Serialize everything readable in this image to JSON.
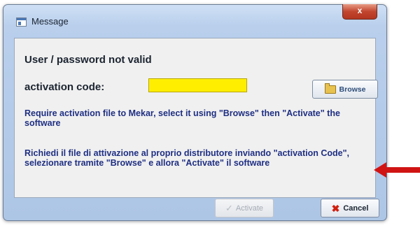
{
  "window": {
    "title": "Message",
    "close_label": "x"
  },
  "message": {
    "title": "User / password not valid",
    "code_label": "activation code:",
    "code_value": "",
    "english_text": "Require activation file to Mekar, select it using \"Browse\" then \"Activate\" the software",
    "italian_text": "Richiedi il file di attivazione al proprio distributore inviando \"activation Code\", selezionare tramite \"Browse\" e allora \"Activate\" il software"
  },
  "buttons": {
    "browse": "Browse",
    "activate": "Activate",
    "cancel": "Cancel"
  },
  "colors": {
    "code_field": "#ffee00",
    "message_text": "#1f2f82",
    "annotation_arrow": "#d01414"
  }
}
